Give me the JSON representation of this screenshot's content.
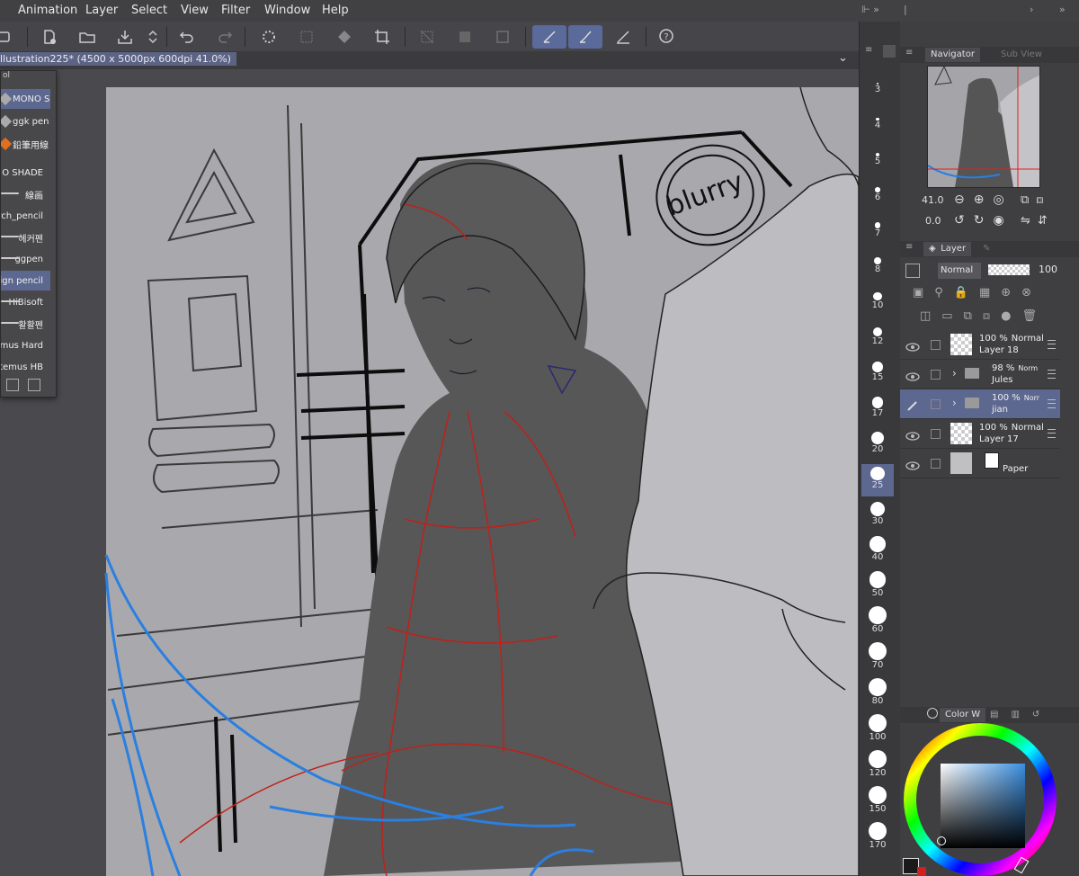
{
  "menubar": {
    "items": [
      "Animation",
      "Layer",
      "Select",
      "View",
      "Filter",
      "Window",
      "Help"
    ]
  },
  "document": {
    "title": "llustration225* (4500 x 5000px 600dpi 41.0%)"
  },
  "subtool": {
    "header": "ol",
    "pens": [
      {
        "label": "MONO S",
        "selected": true,
        "icon": "pen-icon"
      },
      {
        "label": "ggk pen",
        "selected": false,
        "icon": "pen-icon"
      },
      {
        "label": "鉛筆用線",
        "selected": false,
        "icon": "pencil-orange-icon"
      }
    ],
    "brushes": [
      {
        "label": "O SHADE",
        "selected": false
      },
      {
        "label": "線画",
        "selected": false
      },
      {
        "label": "rch_pencil",
        "selected": false
      },
      {
        "label": "헤커펜",
        "selected": false
      },
      {
        "label": "ggpen",
        "selected": false
      },
      {
        "label": "ign pencil",
        "selected": true
      },
      {
        "label": "HiBisoft",
        "selected": false
      },
      {
        "label": "활활펜",
        "selected": false
      },
      {
        "label": "mus Hard",
        "selected": false
      },
      {
        "label": "temus HB",
        "selected": false
      }
    ]
  },
  "brush_sizes": [
    "3",
    "4",
    "5",
    "6",
    "7",
    "8",
    "10",
    "12",
    "15",
    "17",
    "20",
    "25",
    "30",
    "40",
    "50",
    "60",
    "70",
    "80",
    "100",
    "120",
    "150",
    "170"
  ],
  "brush_size_selected": "25",
  "navigator": {
    "tab_label": "Navigator",
    "subview_label": "Sub View",
    "zoom": "41.0",
    "rotation": "0.0"
  },
  "layer_panel": {
    "tab_label": "Layer",
    "blend_mode": "Normal",
    "opacity": "100",
    "layers": [
      {
        "opacity": "100 %",
        "mode": "Normal",
        "name": "Layer 18",
        "type": "raster",
        "selected": false
      },
      {
        "opacity": "98 %",
        "mode": "Norm",
        "name": "Jules",
        "type": "folder",
        "selected": false
      },
      {
        "opacity": "100 %",
        "mode": "Norr",
        "name": "jian",
        "type": "folder",
        "selected": true
      },
      {
        "opacity": "100 %",
        "mode": "Normal",
        "name": "Layer 17",
        "type": "raster",
        "selected": false
      },
      {
        "opacity": "",
        "mode": "",
        "name": "Paper",
        "type": "paper",
        "selected": false
      }
    ]
  },
  "color_panel": {
    "tab_label": "Color W",
    "main_color": "#3a8fe0",
    "fg_color": "#1a1a1a",
    "bg_color": "#d02020"
  },
  "colors": {
    "accent": "#5d6890",
    "canvas_bg": "#a9a9ad",
    "sketch_red": "#c0201a",
    "sketch_blue": "#2a7fe0"
  }
}
